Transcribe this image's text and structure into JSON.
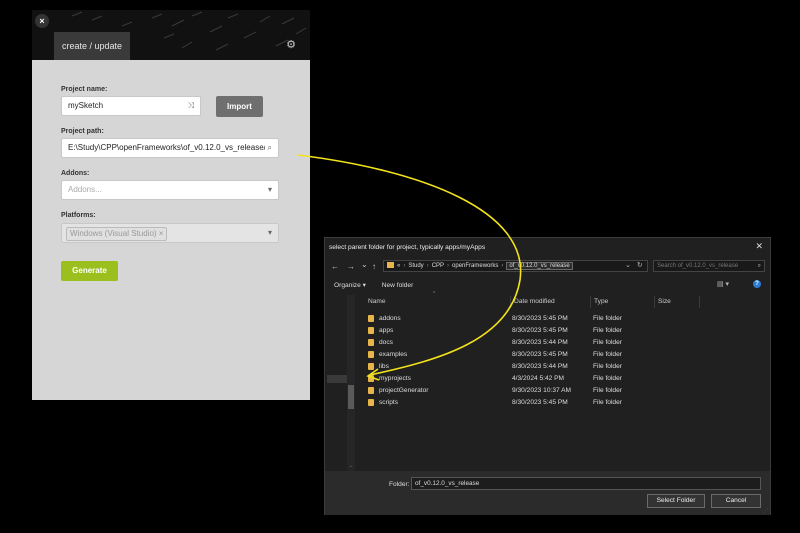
{
  "generator": {
    "close_icon": "×",
    "tab_label": "create / update",
    "gear_icon": "⚙",
    "project_name_label": "Project name:",
    "project_name_value": "mySketch",
    "shuffle_icon": "⤨",
    "import_label": "Import",
    "project_path_label": "Project path:",
    "project_path_value": "E:\\Study\\CPP\\openFrameworks\\of_v0.12.0_vs_release/",
    "search_icon": "⌕",
    "addons_label": "Addons:",
    "addons_placeholder": "Addons...",
    "dropdown_icon": "▾",
    "platforms_label": "Platforms:",
    "platform_chip": "Windows (Visual Studio)",
    "chip_remove_icon": "×",
    "generate_label": "Generate",
    "accent_color": "#9bc01d"
  },
  "dialog": {
    "title": "select parent folder for project, typically apps/myApps",
    "close_icon": "✕",
    "back_icon": "←",
    "forward_icon": "→",
    "history_icon": "⌄",
    "up_icon": "↑",
    "breadcrumb": [
      "Study",
      "CPP",
      "openFrameworks",
      "of_v0.12.0_vs_release"
    ],
    "breadcrumb_overflow": "«",
    "address_dropdown_icon": "⌄",
    "refresh_icon": "↻",
    "search_placeholder": "Search of_v0.12.0_vs_release",
    "search_icon": "⌕",
    "organize_label": "Organize ▾",
    "new_folder_label": "New folder",
    "view_icon": "▤ ▾",
    "help_icon": "?",
    "columns": {
      "name": "Name",
      "date": "Date modified",
      "type": "Type",
      "size": "Size"
    },
    "files": [
      {
        "name": "addons",
        "date": "8/30/2023 5:45 PM",
        "type": "File folder"
      },
      {
        "name": "apps",
        "date": "8/30/2023 5:45 PM",
        "type": "File folder"
      },
      {
        "name": "docs",
        "date": "8/30/2023 5:44 PM",
        "type": "File folder"
      },
      {
        "name": "examples",
        "date": "8/30/2023 5:45 PM",
        "type": "File folder"
      },
      {
        "name": "libs",
        "date": "8/30/2023 5:44 PM",
        "type": "File folder"
      },
      {
        "name": "myprojects",
        "date": "4/3/2024 5:42 PM",
        "type": "File folder"
      },
      {
        "name": "projectGenerator",
        "date": "9/30/2023 10:37 AM",
        "type": "File folder"
      },
      {
        "name": "scripts",
        "date": "8/30/2023 5:45 PM",
        "type": "File folder"
      }
    ],
    "folder_label": "Folder:",
    "folder_value": "of_v0.12.0_vs_release",
    "select_folder_label": "Select Folder",
    "cancel_label": "Cancel",
    "annotation_color": "#f2e21b"
  }
}
